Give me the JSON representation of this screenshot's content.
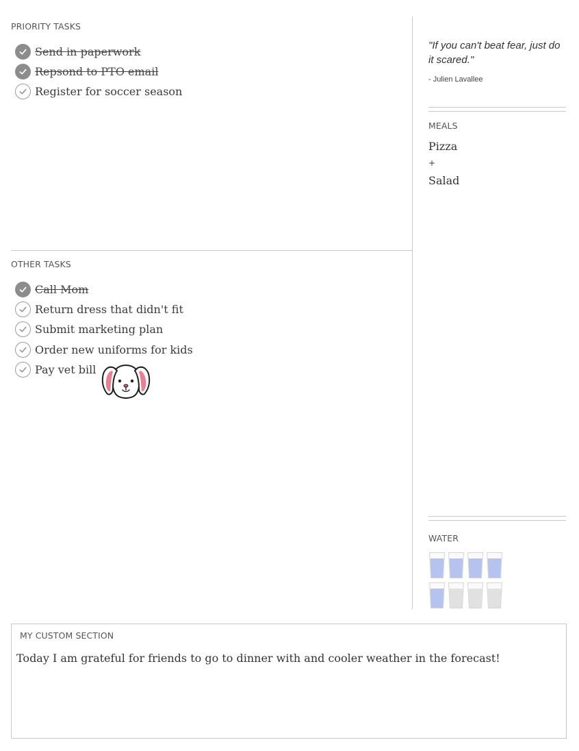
{
  "priority_tasks": {
    "label": "PRIORITY TASKS",
    "items": [
      {
        "text": "Send in paperwork",
        "done": true
      },
      {
        "text": "Repsond to PTO email",
        "done": true
      },
      {
        "text": "Register for soccer season",
        "done": false
      }
    ]
  },
  "other_tasks": {
    "label": "OTHER TASKS",
    "items": [
      {
        "text": "Call Mom",
        "done": true
      },
      {
        "text": "Return dress that didn't fit",
        "done": false
      },
      {
        "text": "Submit marketing plan",
        "done": false
      },
      {
        "text": "Order new uniforms for kids",
        "done": false
      },
      {
        "text": "Pay vet bill",
        "done": false
      }
    ]
  },
  "sticker": {
    "icon": "dog-face-icon"
  },
  "quote": {
    "text": "\"If you can't beat fear, just do it scared.\"",
    "author": "- Julien Lavallee"
  },
  "meals": {
    "label": "MEALS",
    "lines": [
      "Pizza",
      "+",
      "Salad"
    ]
  },
  "water": {
    "label": "WATER",
    "glasses_total": 8,
    "glasses_filled": 5,
    "filled_color": "#b7c3ef",
    "empty_color": "#e1e1e1"
  },
  "custom_section": {
    "label": "MY CUSTOM SECTION",
    "text": "Today I am grateful for friends to go to dinner with and cooler weather in the forecast!"
  },
  "colors": {
    "done_check": "#8c8c8c",
    "divider": "#c8c8c8"
  }
}
